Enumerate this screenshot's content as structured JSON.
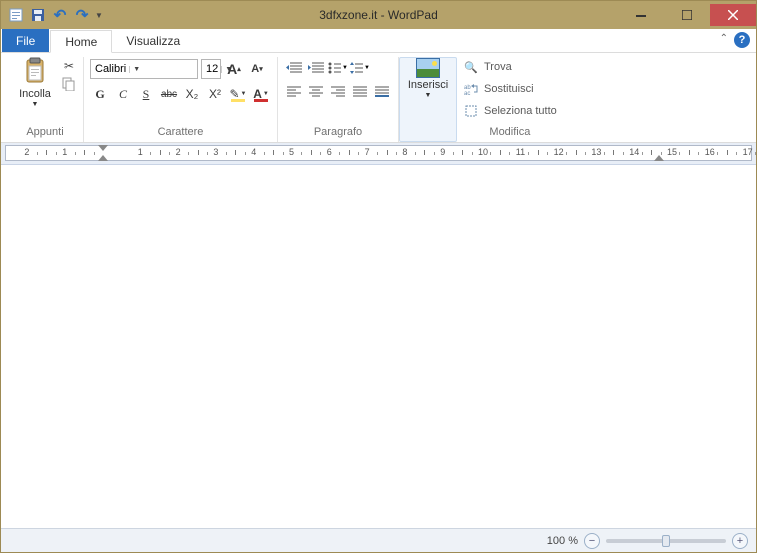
{
  "title": "3dfxzone.it - WordPad",
  "tabs": {
    "file": "File",
    "home": "Home",
    "view": "Visualizza"
  },
  "clipboard": {
    "paste": "Incolla",
    "label": "Appunti"
  },
  "font": {
    "name": "Calibri",
    "size": "12",
    "label": "Carattere",
    "grow": "A",
    "shrink": "A",
    "bold": "G",
    "italic": "C",
    "underline": "S",
    "strike": "abc",
    "sub": "X₂",
    "sup": "X²",
    "highlight": "🖉",
    "color": "A"
  },
  "paragraph": {
    "label": "Paragrafo"
  },
  "insert": {
    "label": "Inserisci"
  },
  "editing": {
    "find": "Trova",
    "replace": "Sostituisci",
    "select": "Seleziona tutto",
    "label": "Modifica"
  },
  "status": {
    "zoom": "100 %"
  },
  "ruler": {
    "marks": [
      -2,
      -1,
      1,
      2,
      3,
      4,
      5,
      6,
      7,
      8,
      9,
      10,
      11,
      12,
      13,
      14,
      15,
      16,
      17
    ]
  }
}
